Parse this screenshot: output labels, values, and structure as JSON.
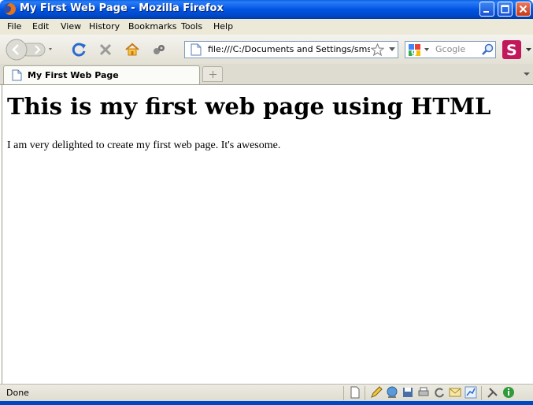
{
  "window": {
    "title": "My First Web Page - Mozilla Firefox"
  },
  "menu": {
    "items": [
      {
        "label": "File"
      },
      {
        "label": "Edit"
      },
      {
        "label": "View"
      },
      {
        "label": "History"
      },
      {
        "label": "Bookmarks"
      },
      {
        "label": "Tools"
      },
      {
        "label": "Help"
      }
    ]
  },
  "toolbar": {
    "url": "file:///C:/Documents and Settings/sms/De:",
    "search_placeholder": "Gcogle",
    "icons": [
      "back-icon",
      "forward-icon",
      "reload-icon",
      "stop-icon",
      "home-icon",
      "addon-icon",
      "bookmark-star-icon",
      "google-icon",
      "search-go-icon",
      "s-addon-icon"
    ]
  },
  "tabs": [
    {
      "label": "My First Web Page",
      "active": true
    }
  ],
  "page": {
    "heading": "This is my first web page using HTML",
    "paragraph": "I am very delighted to create my first web page. It's awesome."
  },
  "status": {
    "text": "Done"
  },
  "colors": {
    "titlebar": "#0054e3",
    "chrome": "#ece9d8",
    "close_button": "#c4391a"
  }
}
